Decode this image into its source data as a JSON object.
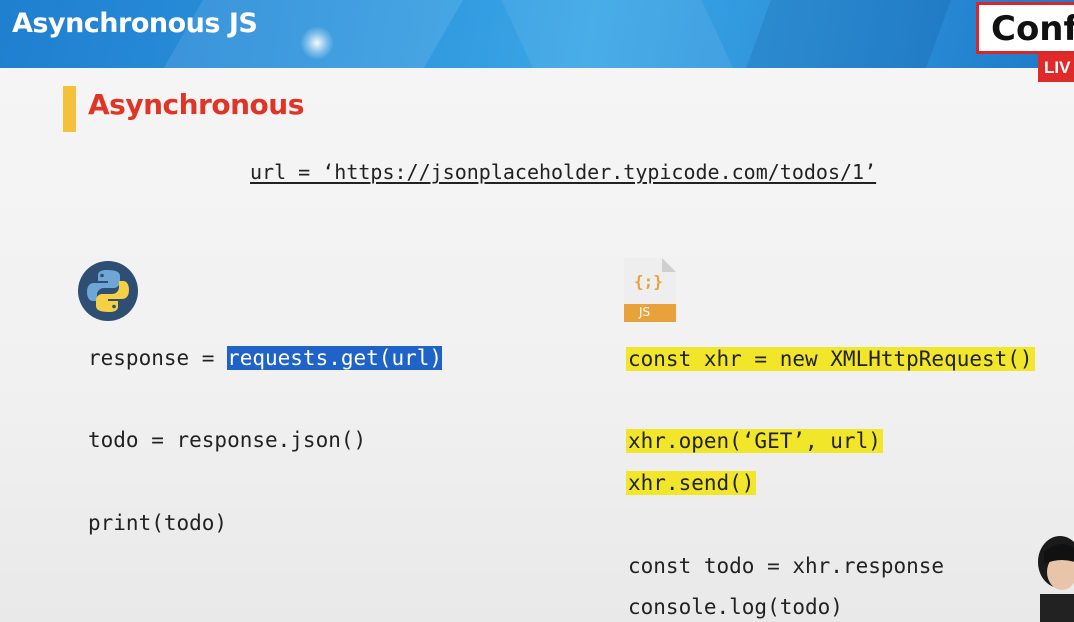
{
  "header": {
    "title": "Asynchronous JS"
  },
  "badge": {
    "text": "Conf",
    "live": "LIV"
  },
  "section": {
    "title": "Asynchronous"
  },
  "url_line": "url = ‘https://jsonplaceholder.typicode.com/todos/1’",
  "python": {
    "logo": "python-logo",
    "lines": {
      "l1_prefix": "response = ",
      "l1_selected": "requests.get(url)",
      "l2": "todo = response.json()",
      "l3": "print(todo)"
    }
  },
  "javascript": {
    "logo": "js-file-icon",
    "logo_text": "JS",
    "logo_glyph": "{;}",
    "lines": {
      "l1": "const xhr = new XMLHttpRequest()",
      "l2": "xhr.open(‘GET’, url)",
      "l3": "xhr.send()",
      "l4": "const todo = xhr.response",
      "l5": "console.log(todo)"
    }
  },
  "colors": {
    "header_blue": "#2b92dc",
    "title_red": "#e03426",
    "accent_yellow": "#f3c13a",
    "highlight_yellow": "#f2e62a",
    "selection_blue": "#1f63c8"
  }
}
